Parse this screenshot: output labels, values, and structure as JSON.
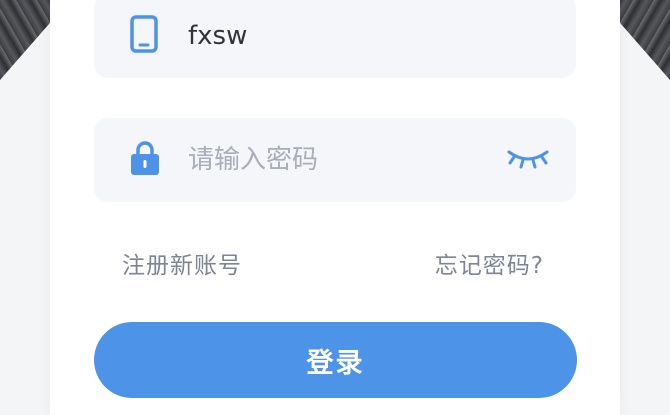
{
  "phone_field": {
    "icon": "phone-icon",
    "value": "fxsw"
  },
  "password_field": {
    "icon": "lock-icon",
    "placeholder": "请输入密码",
    "value": "",
    "visibility_icon": "eye-closed-icon"
  },
  "links": {
    "register": "注册新账号",
    "forgot": "忘记密码?"
  },
  "login_button": {
    "label": "登录"
  },
  "colors": {
    "accent": "#4d93e8",
    "field_background": "#f5f6fa",
    "link_text": "#7d8492",
    "placeholder": "#a8adb8"
  }
}
